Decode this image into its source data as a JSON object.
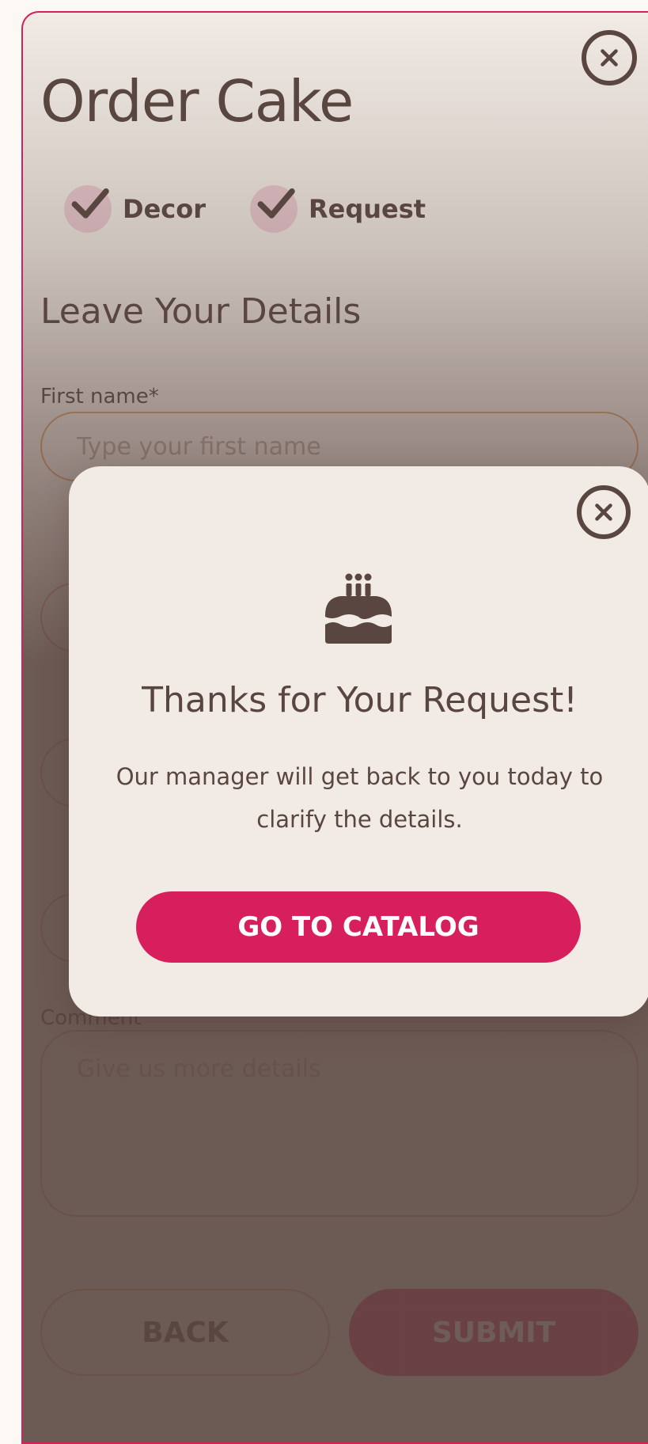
{
  "page": {
    "title": "Order Cake",
    "close_icon": "close-icon"
  },
  "steps": [
    {
      "label": "Decor",
      "icon": "check-icon"
    },
    {
      "label": "Request",
      "icon": "check-icon"
    }
  ],
  "form": {
    "section_title": "Leave Your Details",
    "first_name": {
      "label": "First name*",
      "placeholder": "Type your first name",
      "value": ""
    },
    "comment": {
      "label": "Comment",
      "placeholder": "Give us more details",
      "value": ""
    },
    "back_label": "BACK",
    "submit_label": "SUBMIT"
  },
  "modal": {
    "icon": "cake-icon",
    "title": "Thanks for Your Request!",
    "text": "Our manager will get back to you today to clarify the details.",
    "button_label": "GO TO CATALOG"
  },
  "colors": {
    "accent": "#d81f5e",
    "text": "#5a4640",
    "background": "#f2ebe5",
    "input_border": "#e0a06c"
  }
}
